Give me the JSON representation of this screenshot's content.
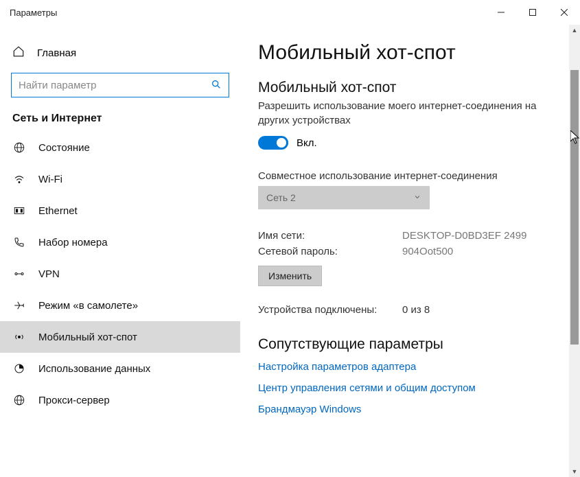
{
  "window": {
    "title": "Параметры"
  },
  "sidebar": {
    "home": "Главная",
    "search_placeholder": "Найти параметр",
    "category": "Сеть и Интернет",
    "items": [
      {
        "label": "Состояние"
      },
      {
        "label": "Wi-Fi"
      },
      {
        "label": "Ethernet"
      },
      {
        "label": "Набор номера"
      },
      {
        "label": "VPN"
      },
      {
        "label": "Режим «в самолете»"
      },
      {
        "label": "Мобильный хот-спот"
      },
      {
        "label": "Использование данных"
      },
      {
        "label": "Прокси-сервер"
      }
    ]
  },
  "main": {
    "title": "Мобильный хот-спот",
    "section_title": "Мобильный хот-спот",
    "section_desc": "Разрешить использование моего интернет-соединения на других устройствах",
    "toggle_label": "Вкл.",
    "share_label": "Совместное использование интернет-соединения",
    "share_value": "Сеть 2",
    "net_name_label": "Имя сети:",
    "net_name_value": "DESKTOP-D0BD3EF 2499",
    "net_pass_label": "Сетевой пароль:",
    "net_pass_value": "904Oot500",
    "edit_btn": "Изменить",
    "connected_label": "Устройства подключены:",
    "connected_value": "0 из 8",
    "related_title": "Сопутствующие параметры",
    "links": [
      "Настройка параметров адаптера",
      "Центр управления сетями и общим доступом",
      "Брандмауэр Windows"
    ]
  }
}
